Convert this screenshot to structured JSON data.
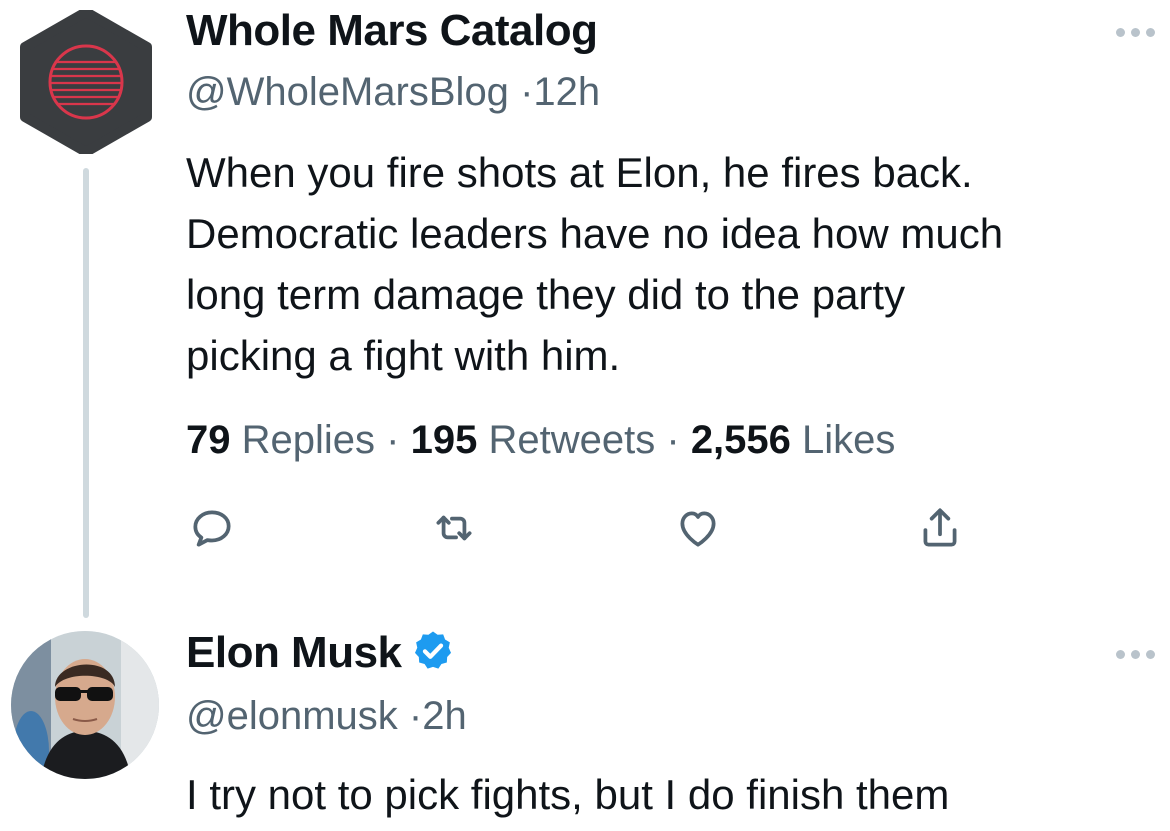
{
  "tweet1": {
    "display_name": "Whole Mars Catalog",
    "handle": "@WholeMarsBlog",
    "separator": "·",
    "time": "12h",
    "text_lines": [
      "When you fire shots at Elon, he fires back.",
      "Democratic leaders have no idea how much",
      "long term damage they did to the party",
      "picking a fight with him."
    ],
    "stats": {
      "replies_count": "79",
      "replies_label": "Replies",
      "retweets_count": "195",
      "retweets_label": "Retweets",
      "likes_count": "2,556",
      "likes_label": "Likes",
      "separator": "·"
    },
    "actions": [
      "reply-icon",
      "retweet-icon",
      "like-icon",
      "share-icon"
    ],
    "avatar_icon": "mars-logo-icon"
  },
  "tweet2": {
    "display_name": "Elon Musk",
    "verified": true,
    "handle": "@elonmusk",
    "separator": "·",
    "time": "2h",
    "text": "I try not to pick fights, but I do finish them",
    "avatar_icon": "profile-photo"
  },
  "colors": {
    "text": "#0f1419",
    "secondary": "#536471",
    "verified_blue": "#1d9bf0",
    "thread_line": "#cfd9de",
    "logo_red": "#d9364b",
    "logo_bg": "#3a3d40"
  }
}
